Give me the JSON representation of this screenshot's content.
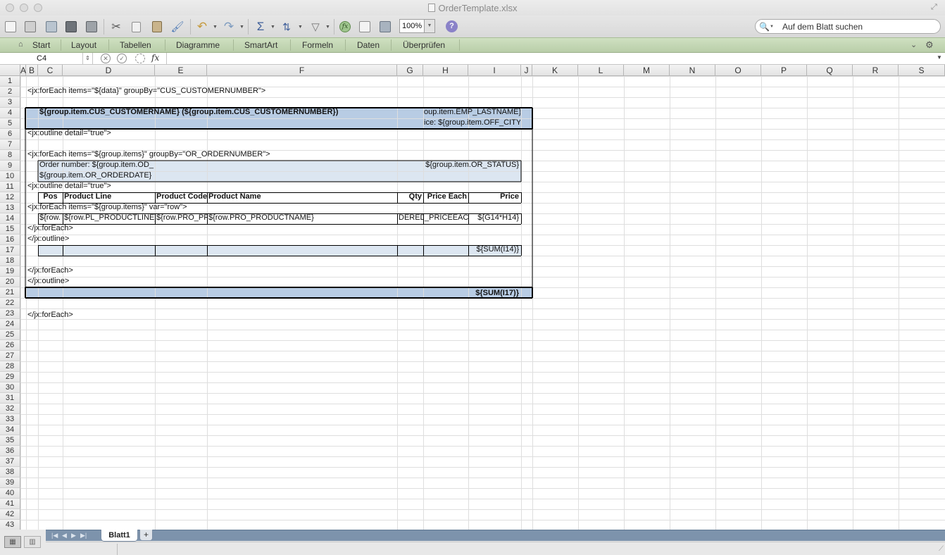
{
  "window": {
    "title": "OrderTemplate.xlsx"
  },
  "toolbar": {
    "zoom": "100%",
    "search_placeholder": "Auf dem Blatt suchen",
    "icons": [
      "new-workbook-icon",
      "templates-icon",
      "open-icon",
      "save-icon",
      "print-icon",
      "cut-icon",
      "copy-icon",
      "paste-icon",
      "format-painter-icon",
      "undo-icon",
      "redo-icon",
      "autosum-icon",
      "sort-icon",
      "filter-icon",
      "function-icon",
      "show-formula-builder-icon",
      "gallery-icon",
      "toolbox-icon",
      "help-icon",
      "search-icon"
    ]
  },
  "ribbon": {
    "tabs": [
      "Start",
      "Layout",
      "Tabellen",
      "Diagramme",
      "SmartArt",
      "Formeln",
      "Daten",
      "Überprüfen"
    ]
  },
  "formula_bar": {
    "cell_ref": "C4",
    "fx": "fx",
    "formula": ""
  },
  "grid": {
    "columns": [
      "A",
      "B",
      "C",
      "D",
      "E",
      "F",
      "G",
      "H",
      "I",
      "J",
      "K",
      "L",
      "M",
      "N",
      "O",
      "P",
      "Q",
      "R",
      "S"
    ],
    "rows": [
      "1",
      "2",
      "3",
      "4",
      "5",
      "6",
      "7",
      "8",
      "9",
      "10",
      "11",
      "12",
      "13",
      "14",
      "15",
      "16",
      "17",
      "18",
      "19",
      "20",
      "21",
      "22",
      "23",
      "24",
      "25",
      "26",
      "27",
      "28",
      "29",
      "30",
      "31",
      "32",
      "33",
      "34",
      "35",
      "36",
      "37",
      "38",
      "39",
      "40",
      "41",
      "42",
      "43"
    ],
    "cells": {
      "B2": "<jx:forEach items=\"${data}\" groupBy=\"CUS_CUSTOMERNUMBER\">",
      "C4": "${group.item.CUS_CUSTOMERNAME} (${group.item.CUS_CUSTOMERNUMBER})",
      "I4": "oup.item.EMP_LASTNAME}",
      "I5": "ice: ${group.item.OFF_CITY}",
      "B6": "<jx:outline detail=\"true\">",
      "B8": "<jx:forEach items=\"${group.items}\" groupBy=\"OR_ORDERNUMBER\">",
      "C9": "Order number: ${group.item.OD_",
      "I9": "${group.item.OR_STATUS}",
      "C10": "${group.item.OR_ORDERDATE}",
      "B11": "<jx:outline detail=\"true\">",
      "C12": "Pos",
      "D12": "Product Line",
      "E12": "Product Code",
      "F12": "Product Name",
      "G12": "Qty",
      "H12": "Price Each",
      "I12": "Price",
      "B13": "<jx:forEach items=\"${group.items}\" var=\"row\">",
      "C14": "${row.",
      "D14": "${row.PL_PRODUCTLINE}",
      "E14": "${row.PRO_PR",
      "F14": "${row.PRO_PRODUCTNAME}",
      "G14": "DERED}",
      "H14": "_PRICEEACH}",
      "I14": "${G14*H14}",
      "B15": "</jx:forEach>",
      "B16": "</jx:outline>",
      "I17": "${SUM(I14)}",
      "B19": "</jx:forEach>",
      "B20": "</jx:outline>",
      "I21": "${SUM(I17)}",
      "B23": "</jx:forEach>"
    },
    "colors": {
      "header_band": "#b8cce4",
      "order_band": "#dce6f1",
      "border": "#000000",
      "gridline": "#dedede"
    }
  },
  "sheets": {
    "tabs": [
      "Blatt1"
    ],
    "add_label": "+"
  }
}
